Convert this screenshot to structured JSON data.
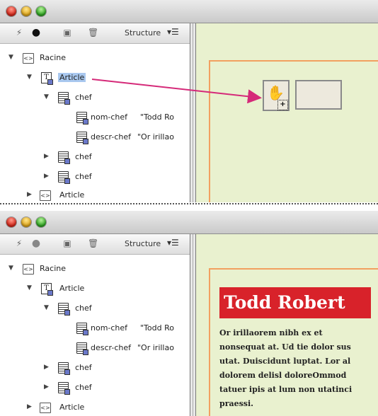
{
  "toolbar": {
    "structure_label": "Structure",
    "menu_glyph": "▾☰"
  },
  "tree": {
    "root": "Racine",
    "article": "Article",
    "chef": "chef",
    "nom_chef": "nom-chef",
    "nom_chef_value": "\"Todd Ro",
    "descr_chef": "descr-chef",
    "descr_chef_value": "\"Or irillao",
    "chef2": "chef",
    "chef3": "chef",
    "article2": "Article"
  },
  "content": {
    "name": "Todd Robert",
    "body_lines": [
      "Or irillaorem nibh ex et",
      "nonsequat at. Ud tie dolor sus",
      "utat. Duiscidunt luptat. Lor al",
      "dolorem delisl doloreOmmod",
      "tatuer ipis at lum non utatinci",
      "praessi."
    ]
  },
  "colors": {
    "arrow": "#d52a79",
    "title_bg": "#d8222a",
    "canvas_bg": "#e9f1cf",
    "frame_border": "#f2a060"
  },
  "icons": {
    "toolbar": [
      "lightning-icon",
      "circle-icon",
      "square-icon",
      "trash-icon"
    ],
    "tree": [
      "tag-icon",
      "text-icon",
      "doc-icon"
    ]
  }
}
